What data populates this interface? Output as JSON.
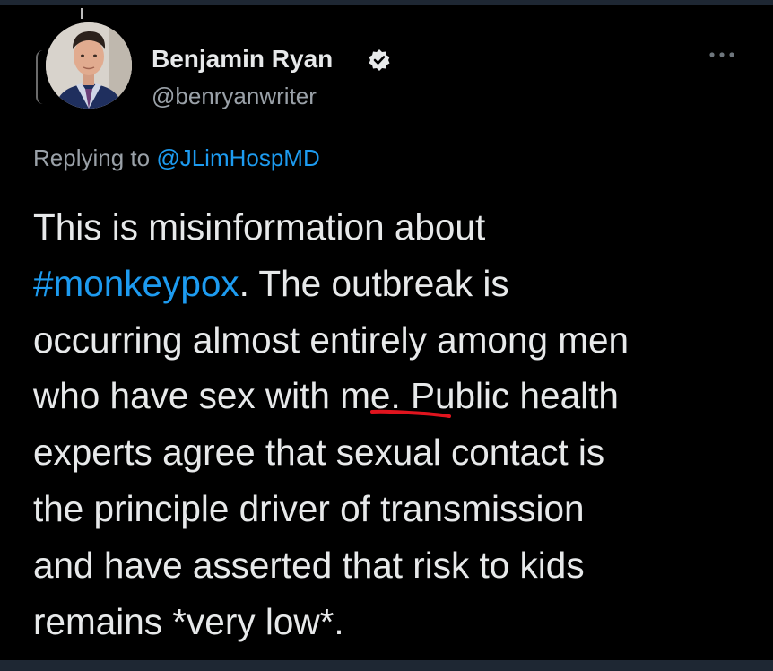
{
  "tweet": {
    "author": {
      "display_name": "Benjamin Ryan",
      "handle": "@benryanwriter",
      "verified": true
    },
    "reply": {
      "prefix": "Replying to",
      "mention": "@JLimHospMD"
    },
    "body": {
      "line1": "This is misinformation about",
      "hashtag": "#monkeypox",
      "line2_rest": ". The outbreak is",
      "line3": "occurring almost entirely among men",
      "line4_before": "who have sex with ",
      "line4_underlined": "me.",
      "line4_after": " Public health",
      "line5": "experts agree that sexual contact is",
      "line6": "the principle driver of transmission",
      "line7": "and have asserted that risk to kids",
      "line8": "remains *very low*."
    }
  },
  "icons": {
    "verified": "verified-badge-icon",
    "more": "more-options-icon",
    "annotation": "red-underline-annotation"
  },
  "colors": {
    "background": "#000000",
    "text": "#e7e9ea",
    "secondary_text": "#9aa1a8",
    "link": "#1d9bf0",
    "annotation": "#e0141e",
    "frame": "#1e2733"
  }
}
